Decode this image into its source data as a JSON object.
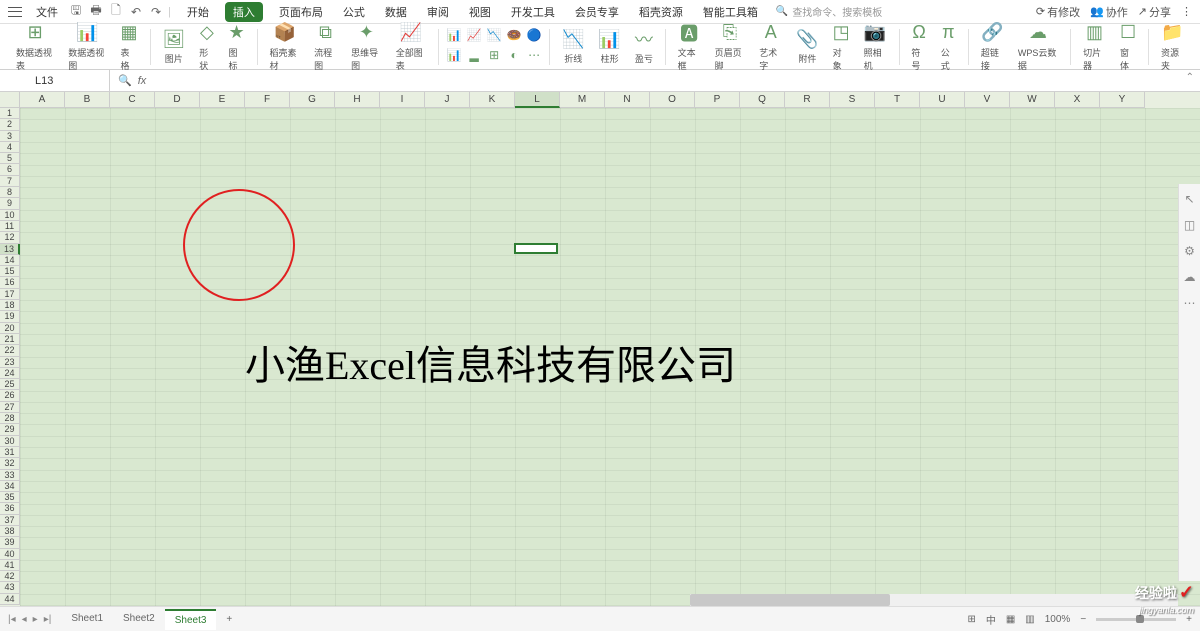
{
  "menubar": {
    "file": "文件",
    "tabs": [
      "开始",
      "插入",
      "页面布局",
      "公式",
      "数据",
      "审阅",
      "视图",
      "开发工具",
      "会员专享",
      "稻壳资源",
      "智能工具箱"
    ],
    "active_tab": 1,
    "search_placeholder": "查找命令、搜索模板",
    "right": {
      "modified": "有修改",
      "collab": "协作",
      "share": "分享"
    }
  },
  "ribbon": {
    "groups": [
      "数据透视表",
      "数据透视图",
      "表格",
      "图片",
      "形状",
      "图标",
      "稻壳素材",
      "流程图",
      "思维导图",
      "全部图表",
      "",
      "折线",
      "柱形",
      "盈亏",
      "文本框",
      "页眉页脚",
      "艺术字",
      "附件",
      "对象",
      "照相机",
      "符号",
      "公式",
      "超链接",
      "WPS云数据",
      "切片器",
      "窗体",
      "资源夹"
    ]
  },
  "namebox": {
    "cell": "L13",
    "fx": "fx"
  },
  "columns": [
    "A",
    "B",
    "C",
    "D",
    "E",
    "F",
    "G",
    "H",
    "I",
    "J",
    "K",
    "L",
    "M",
    "N",
    "O",
    "P",
    "Q",
    "R",
    "S",
    "T",
    "U",
    "V",
    "W",
    "X",
    "Y"
  ],
  "active_col": "L",
  "row_count": 44,
  "active_row": 13,
  "watermark_text": "小渔Excel信息科技有限公司",
  "sheets": {
    "list": [
      "Sheet1",
      "Sheet2",
      "Sheet3"
    ],
    "active": 2,
    "add": "+"
  },
  "status": {
    "zoom": "100%",
    "lang": "中"
  },
  "logo": {
    "text": "经验啦",
    "sub": "jingyanla.com"
  }
}
